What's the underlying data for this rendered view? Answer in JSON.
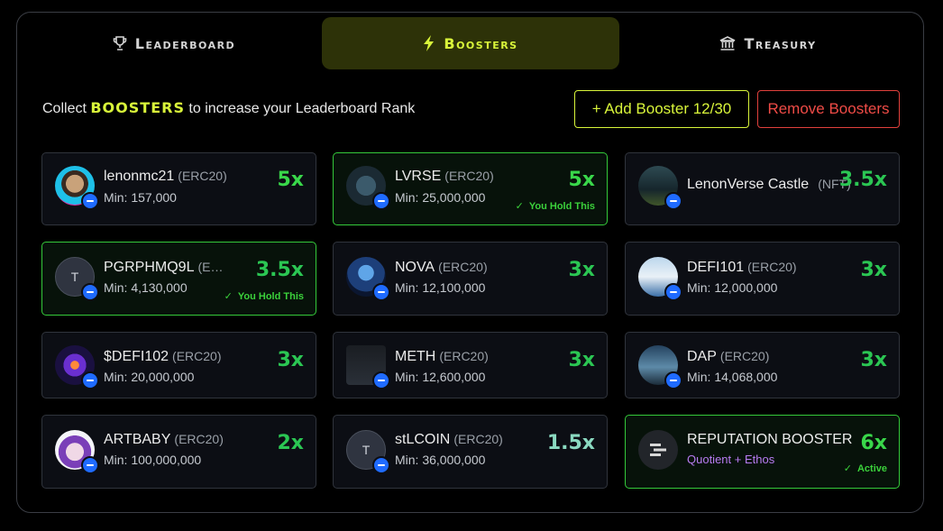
{
  "tabs": [
    {
      "label": "Leaderboard",
      "icon": "trophy-icon"
    },
    {
      "label": "Boosters",
      "icon": "lightning-icon"
    },
    {
      "label": "Treasury",
      "icon": "bank-icon"
    }
  ],
  "intro": {
    "before": "Collect",
    "keyword": "BOOSTERS",
    "after": "to increase your Leaderboard Rank"
  },
  "buttons": {
    "add": "+ Add Booster 12/30",
    "remove": "Remove Boosters"
  },
  "colors": {
    "accent": "#d9f53a",
    "held": "#34c93a",
    "remove": "#ef4b46",
    "multiplier": "#2bc653",
    "chain": "#1f6bff"
  },
  "cards": [
    {
      "name": "lenonmc21",
      "tag": "(ERC20)",
      "min": "Min: 157,000",
      "mult": "5x"
    },
    {
      "name": "LVRSE",
      "tag": "(ERC20)",
      "min": "Min: 25,000,000",
      "mult": "5x",
      "status": "You Hold This"
    },
    {
      "name": "LenonVerse Castle",
      "tag": "(NFT)",
      "min": "",
      "mult": "3.5x"
    },
    {
      "name": "PGRPHMQ9L",
      "tag": "(E…",
      "min": "Min: 4,130,000",
      "mult": "3.5x",
      "status": "You Hold This",
      "letter": "T"
    },
    {
      "name": "NOVA",
      "tag": "(ERC20)",
      "min": "Min: 12,100,000",
      "mult": "3x"
    },
    {
      "name": "DEFI101",
      "tag": "(ERC20)",
      "min": "Min: 12,000,000",
      "mult": "3x"
    },
    {
      "name": "$DEFI102",
      "tag": "(ERC20)",
      "min": "Min: 20,000,000",
      "mult": "3x"
    },
    {
      "name": "METH",
      "tag": "(ERC20)",
      "min": "Min: 12,600,000",
      "mult": "3x"
    },
    {
      "name": "DAP",
      "tag": "(ERC20)",
      "min": "Min: 14,068,000",
      "mult": "3x"
    },
    {
      "name": "ARTBABY",
      "tag": "(ERC20)",
      "min": "Min: 100,000,000",
      "mult": "2x"
    },
    {
      "name": "stLCOIN",
      "tag": "(ERC20)",
      "min": "Min: 36,000,000",
      "mult": "1.5x",
      "letter": "T"
    },
    {
      "name": "REPUTATION BOOSTER",
      "tag": "",
      "sub": "Quotient + Ethos",
      "mult": "6x",
      "status": "Active"
    }
  ]
}
